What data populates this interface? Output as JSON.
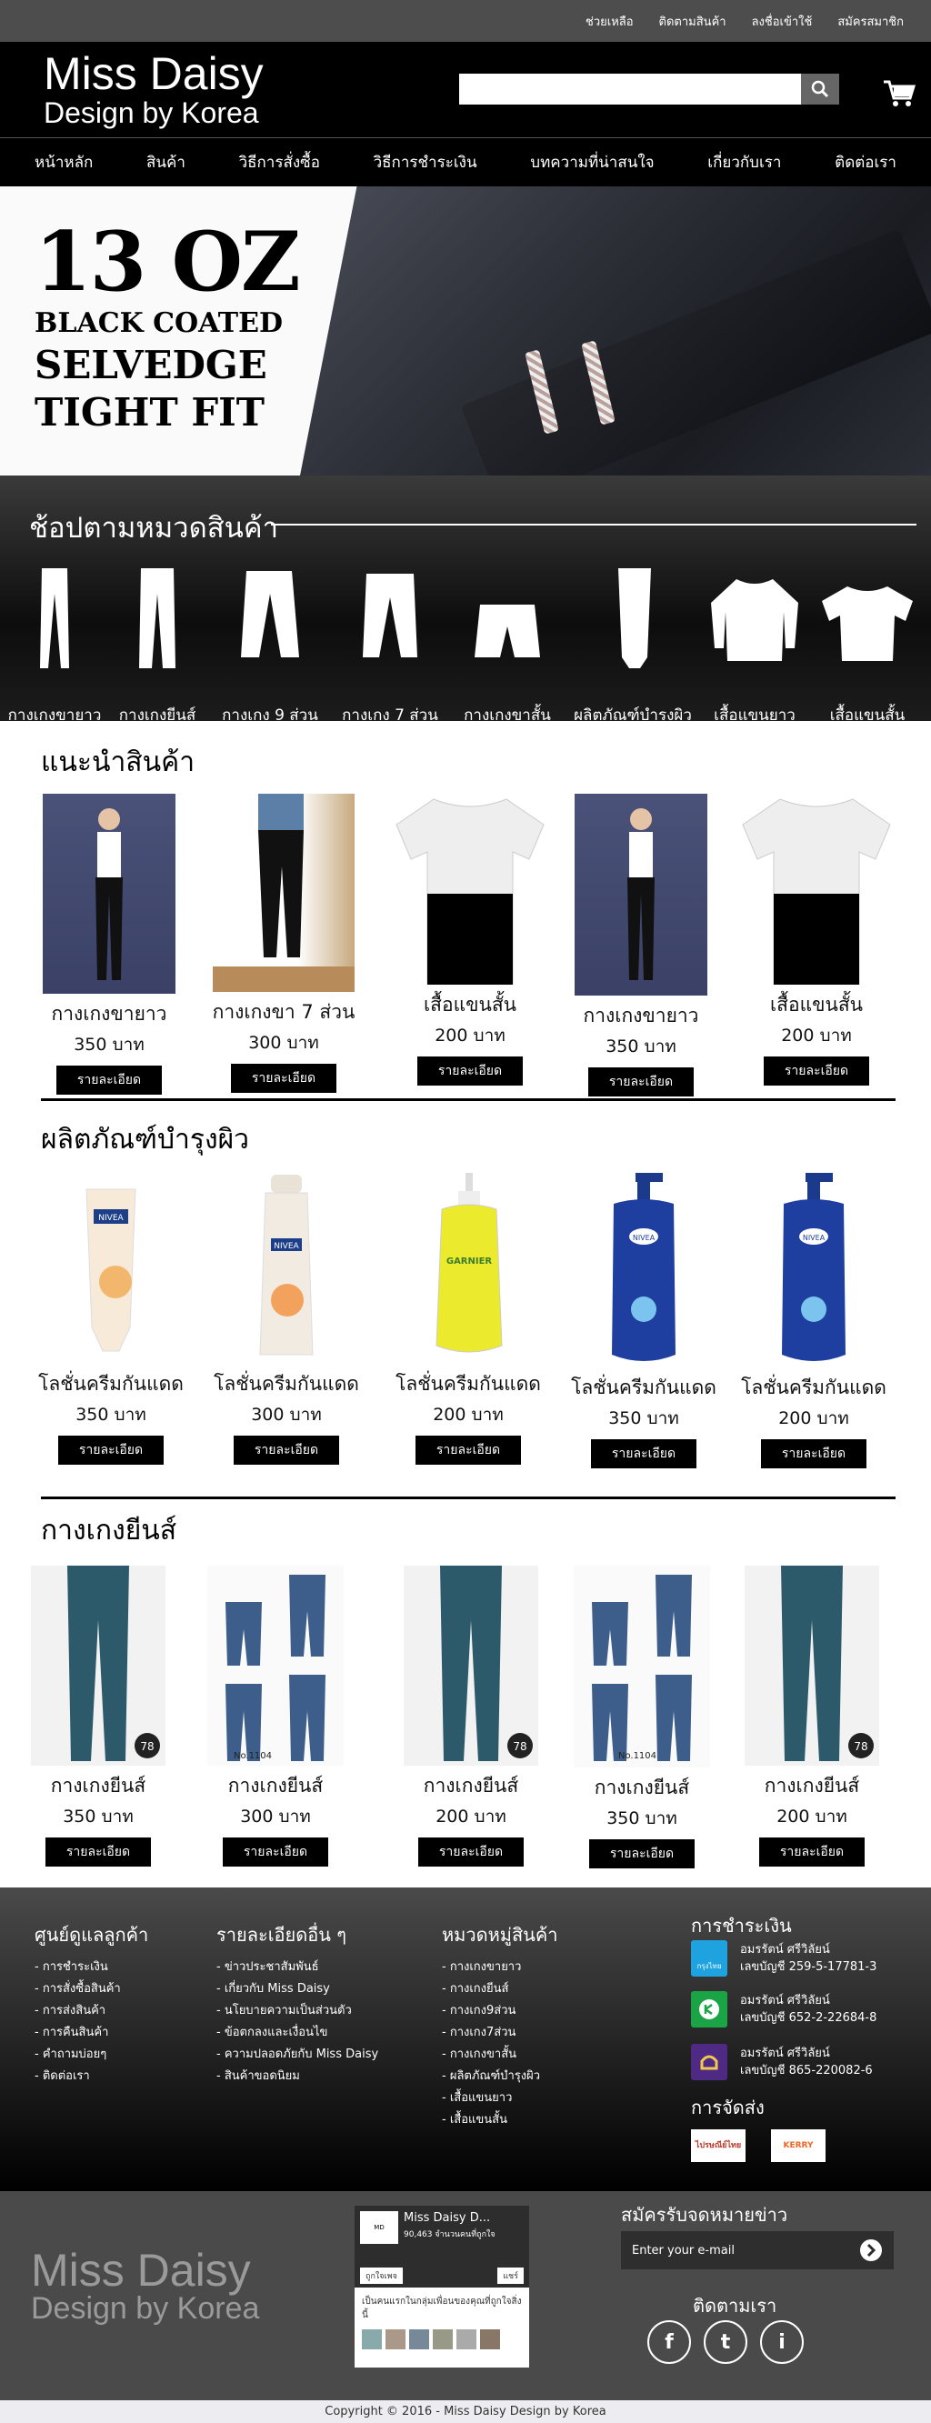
{
  "topbar": {
    "links": [
      "ช่วยเหลือ",
      "ติดตามสินค้า",
      "ลงชื่อเข้าใช้",
      "สมัครสมาชิก"
    ]
  },
  "header": {
    "logo_line1": "Miss Daisy",
    "logo_line2": "Design by Korea",
    "search_placeholder": ""
  },
  "nav": [
    "หน้าหลัก",
    "สินค้า",
    "วิธีการสั่งซื้อ",
    "วิธีการชำระเงิน",
    "บทความที่น่าสนใจ",
    "เกี่ยวกับเรา",
    "ติดต่อเรา"
  ],
  "hero": {
    "line1": "13 OZ",
    "line2": "BLACK COATED",
    "line3": "SELVEDGE",
    "line4": "TIGHT FIT"
  },
  "categories": {
    "title": "ช้อปตามหมวดสินค้า",
    "items": [
      "กางเกงขายาว",
      "กางเกงยีนส์",
      "กางเกง 9 ส่วน",
      "กางเกง 7 ส่วน",
      "กางเกงขาสั้น",
      "ผลิตภัณฑ์บำรุงผิว",
      "เสื้อแขนยาว",
      "เสื้อแขนสั้น"
    ]
  },
  "section1": {
    "title": "แนะนำสินค้า",
    "products": [
      {
        "name": "กางเกงขายาว",
        "price": "350 บาท",
        "button": "รายละเอียด"
      },
      {
        "name": "กางเกงขา 7 ส่วน",
        "price": "300 บาท",
        "button": "รายละเอียด"
      },
      {
        "name": "เสื้อแขนสั้น",
        "price": "200 บาท",
        "button": "รายละเอียด"
      },
      {
        "name": "กางเกงขายาว",
        "price": "350 บาท",
        "button": "รายละเอียด"
      },
      {
        "name": "เสื้อแขนสั้น",
        "price": "200 บาท",
        "button": "รายละเอียด"
      }
    ]
  },
  "section2": {
    "title": "ผลิตภัณฑ์บำรุงผิว",
    "products": [
      {
        "name": "โลชั่นครีมกันแดด",
        "price": "350 บาท",
        "button": "รายละเอียด",
        "brand": "NIVEA"
      },
      {
        "name": "โลชั่นครีมกันแดด",
        "price": "300 บาท",
        "button": "รายละเอียด",
        "brand": "NIVEA"
      },
      {
        "name": "โลชั่นครีมกันแดด",
        "price": "200 บาท",
        "button": "รายละเอียด",
        "brand": "GARNIER"
      },
      {
        "name": "โลชั่นครีมกันแดด",
        "price": "350 บาท",
        "button": "รายละเอียด",
        "brand": "NIVEA"
      },
      {
        "name": "โลชั่นครีมกันแดด",
        "price": "200 บาท",
        "button": "รายละเอียด",
        "brand": "NIVEA"
      }
    ]
  },
  "section3": {
    "title": "กางเกงยีนส์",
    "products": [
      {
        "name": "กางเกงยีนส์",
        "price": "350 บาท",
        "button": "รายละเอียด",
        "tag": "78"
      },
      {
        "name": "กางเกงยีนส์",
        "price": "300 บาท",
        "button": "รายละเอียด",
        "tag": "No.1104"
      },
      {
        "name": "กางเกงยีนส์",
        "price": "200 บาท",
        "button": "รายละเอียด",
        "tag": "78"
      },
      {
        "name": "กางเกงยีนส์",
        "price": "350 บาท",
        "button": "รายละเอียด",
        "tag": "No.1104"
      },
      {
        "name": "กางเกงยีนส์",
        "price": "200 บาท",
        "button": "รายละเอียด",
        "tag": "78"
      }
    ]
  },
  "footer": {
    "col1": {
      "title": "ศูนย์ดูแลลูกค้า",
      "items": [
        "- การชำระเงิน",
        "- การสั่งซื้อสินค้า",
        "- การส่งสินค้า",
        "- การคืนสินค้า",
        "- คำถามบ่อยๆ",
        "- ติดต่อเรา"
      ]
    },
    "col2": {
      "title": "รายละเอียดอื่น ๆ",
      "items": [
        "- ข่าวประชาสัมพันธ์",
        "- เกี่ยวกับ Miss Daisy",
        "- นโยบายความเป็นส่วนตัว",
        "- ข้อตกลงและเงื่อนไข",
        "- ความปลอดภัยกับ Miss Daisy",
        "- สินค้าขอดนิยม"
      ]
    },
    "col3": {
      "title": "หมวดหมู่สินค้า",
      "items": [
        "- กางเกงขายาว",
        "- กางเกงยีนส์",
        "- กางเกง9ส่วน",
        "- กางเกง7ส่วน",
        "- กางเกงขาสั้น",
        "- ผลิตภัณฑ์บำรุงผิว",
        "- เสื้อแขนยาว",
        "- เสื้อแขนสั้น"
      ]
    },
    "payment_title": "การชำระเงิน",
    "banks": [
      {
        "name": "อมรรัตน์ ศรีวิลัยน์",
        "account": "เลขบัญชี 259-5-17781-3",
        "color": "#1fa3e0",
        "logo_text": "กรุงไทย"
      },
      {
        "name": "อมรรัตน์ ศรีวิลัยน์",
        "account": "เลขบัญชี 652-2-22684-8",
        "color": "#1ba446",
        "logo_text": ""
      },
      {
        "name": "อมรรัตน์ ศรีวิลัยน์",
        "account": "เลขบัญชี 865-220082-6",
        "color": "#4e2a84",
        "logo_text": ""
      }
    ],
    "shipping_title": "การจัดส่ง",
    "shipping": [
      "ไปรษณีย์ไทย",
      "KERRY"
    ]
  },
  "footer2": {
    "logo_line1": "Miss Daisy",
    "logo_line2": "Design by Korea",
    "fb": {
      "page_name": "Miss Daisy D...",
      "likes": "90,463 จำนวนคนที่ถูกใจ",
      "like_btn": "ถูกใจเพจ",
      "share_btn": "แชร์",
      "friends_text": "เป็นคนแรกในกลุ่มเพื่อนของคุณที่ถูกใจสิ่งนี้"
    },
    "newsletter_title": "สมัครรับจดหมายข่าว",
    "newsletter_placeholder": "Enter your e-mail",
    "follow_title": "ติดตามเรา",
    "social": [
      "f",
      "t",
      "i"
    ]
  },
  "copyright": "Copyright © 2016 - Miss Daisy Design by Korea"
}
